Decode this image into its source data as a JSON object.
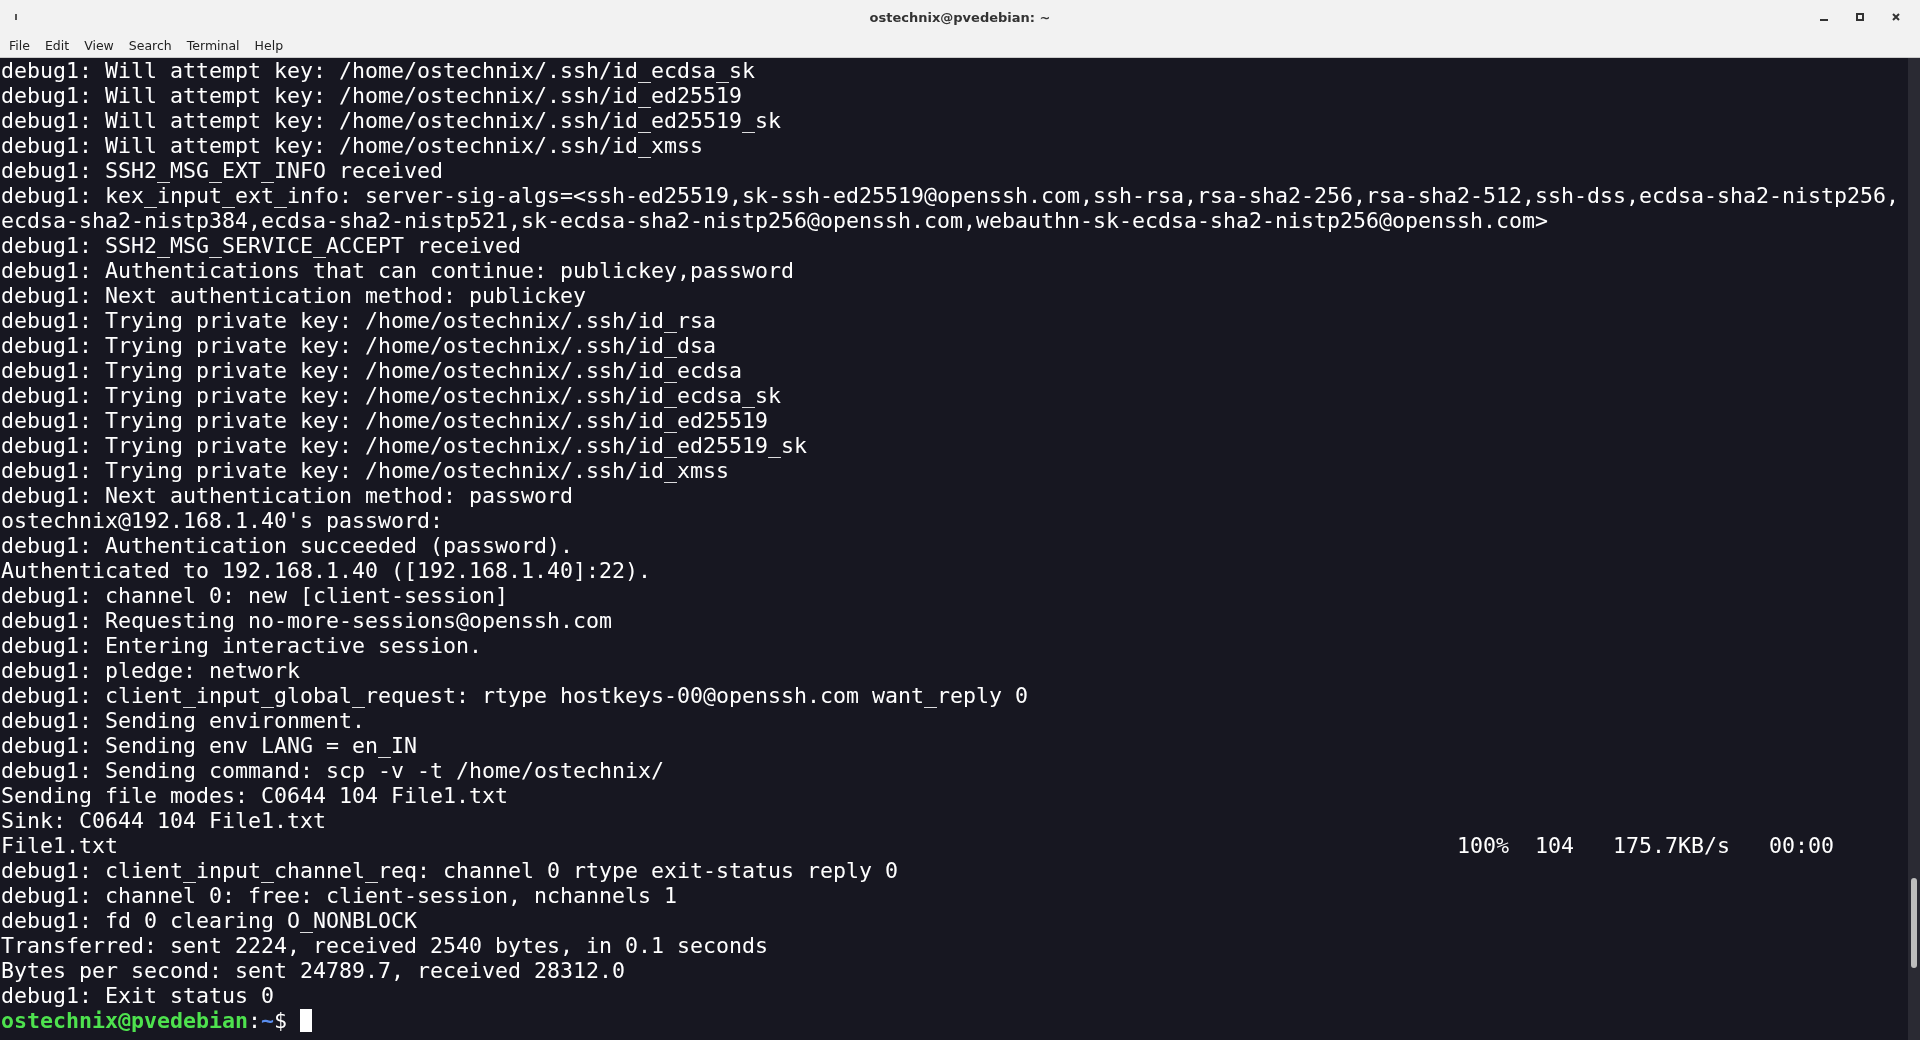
{
  "window": {
    "title": "ostechnix@pvedebian: ~"
  },
  "menu": [
    "File",
    "Edit",
    "View",
    "Search",
    "Terminal",
    "Help"
  ],
  "terminal": {
    "lines": [
      {
        "kind": "text",
        "text": "debug1: Will attempt key: /home/ostechnix/.ssh/id_ecdsa_sk"
      },
      {
        "kind": "text",
        "text": "debug1: Will attempt key: /home/ostechnix/.ssh/id_ed25519"
      },
      {
        "kind": "text",
        "text": "debug1: Will attempt key: /home/ostechnix/.ssh/id_ed25519_sk"
      },
      {
        "kind": "text",
        "text": "debug1: Will attempt key: /home/ostechnix/.ssh/id_xmss"
      },
      {
        "kind": "text",
        "text": "debug1: SSH2_MSG_EXT_INFO received"
      },
      {
        "kind": "text",
        "text": "debug1: kex_input_ext_info: server-sig-algs=<ssh-ed25519,sk-ssh-ed25519@openssh.com,ssh-rsa,rsa-sha2-256,rsa-sha2-512,ssh-dss,ecdsa-sha2-nistp256,"
      },
      {
        "kind": "text",
        "text": "ecdsa-sha2-nistp384,ecdsa-sha2-nistp521,sk-ecdsa-sha2-nistp256@openssh.com,webauthn-sk-ecdsa-sha2-nistp256@openssh.com>"
      },
      {
        "kind": "text",
        "text": "debug1: SSH2_MSG_SERVICE_ACCEPT received"
      },
      {
        "kind": "text",
        "text": "debug1: Authentications that can continue: publickey,password"
      },
      {
        "kind": "text",
        "text": "debug1: Next authentication method: publickey"
      },
      {
        "kind": "text",
        "text": "debug1: Trying private key: /home/ostechnix/.ssh/id_rsa"
      },
      {
        "kind": "text",
        "text": "debug1: Trying private key: /home/ostechnix/.ssh/id_dsa"
      },
      {
        "kind": "text",
        "text": "debug1: Trying private key: /home/ostechnix/.ssh/id_ecdsa"
      },
      {
        "kind": "text",
        "text": "debug1: Trying private key: /home/ostechnix/.ssh/id_ecdsa_sk"
      },
      {
        "kind": "text",
        "text": "debug1: Trying private key: /home/ostechnix/.ssh/id_ed25519"
      },
      {
        "kind": "text",
        "text": "debug1: Trying private key: /home/ostechnix/.ssh/id_ed25519_sk"
      },
      {
        "kind": "text",
        "text": "debug1: Trying private key: /home/ostechnix/.ssh/id_xmss"
      },
      {
        "kind": "text",
        "text": "debug1: Next authentication method: password"
      },
      {
        "kind": "text",
        "text": "ostechnix@192.168.1.40's password:"
      },
      {
        "kind": "text",
        "text": "debug1: Authentication succeeded (password)."
      },
      {
        "kind": "text",
        "text": "Authenticated to 192.168.1.40 ([192.168.1.40]:22)."
      },
      {
        "kind": "text",
        "text": "debug1: channel 0: new [client-session]"
      },
      {
        "kind": "text",
        "text": "debug1: Requesting no-more-sessions@openssh.com"
      },
      {
        "kind": "text",
        "text": "debug1: Entering interactive session."
      },
      {
        "kind": "text",
        "text": "debug1: pledge: network"
      },
      {
        "kind": "text",
        "text": "debug1: client_input_global_request: rtype hostkeys-00@openssh.com want_reply 0"
      },
      {
        "kind": "text",
        "text": "debug1: Sending environment."
      },
      {
        "kind": "text",
        "text": "debug1: Sending env LANG = en_IN"
      },
      {
        "kind": "text",
        "text": "debug1: Sending command: scp -v -t /home/ostechnix/"
      },
      {
        "kind": "text",
        "text": "Sending file modes: C0644 104 File1.txt"
      },
      {
        "kind": "text",
        "text": "Sink: C0644 104 File1.txt"
      },
      {
        "kind": "progress",
        "file": "File1.txt",
        "percent": "100%",
        "size": "104",
        "rate": "175.7KB/s",
        "eta": "00:00"
      },
      {
        "kind": "text",
        "text": "debug1: client_input_channel_req: channel 0 rtype exit-status reply 0"
      },
      {
        "kind": "text",
        "text": "debug1: channel 0: free: client-session, nchannels 1"
      },
      {
        "kind": "text",
        "text": "debug1: fd 0 clearing O_NONBLOCK"
      },
      {
        "kind": "text",
        "text": "Transferred: sent 2224, received 2540 bytes, in 0.1 seconds"
      },
      {
        "kind": "text",
        "text": "Bytes per second: sent 24789.7, received 28312.0"
      },
      {
        "kind": "text",
        "text": "debug1: Exit status 0"
      },
      {
        "kind": "prompt",
        "user_host": "ostechnix@pvedebian",
        "separator": ":",
        "path": "~",
        "symbol": "$"
      }
    ]
  }
}
